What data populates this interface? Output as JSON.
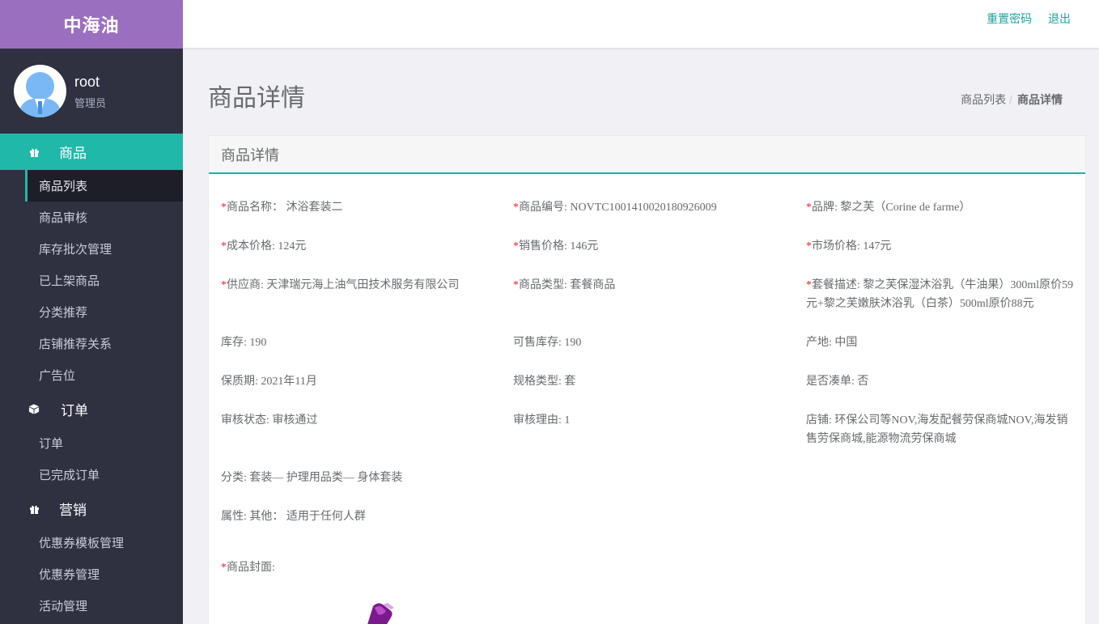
{
  "brand": "中海油",
  "user": {
    "name": "root",
    "role": "管理员"
  },
  "nav": {
    "group_goods": "商品",
    "goods_items": [
      "商品列表",
      "商品审核",
      "库存批次管理",
      "已上架商品",
      "分类推荐",
      "店铺推荐关系",
      "广告位"
    ],
    "group_orders": "订单",
    "order_items": [
      "订单",
      "已完成订单"
    ],
    "group_marketing": "营销",
    "marketing_items": [
      "优惠券模板管理",
      "优惠券管理",
      "活动管理"
    ]
  },
  "header": {
    "reset_password": "重置密码",
    "logout": "退出"
  },
  "page": {
    "title": "商品详情",
    "breadcrumb": [
      "商品列表",
      "/",
      "商品详情"
    ],
    "card_title": "商品详情"
  },
  "fields": {
    "name": {
      "label": "商品名称：",
      "value": "沐浴套装二"
    },
    "code": {
      "label": "商品编号: ",
      "value": "NOVTC1001410020180926009"
    },
    "brand": {
      "label": "品牌: ",
      "value": "黎之芙（Corine de farme）"
    },
    "cost": {
      "label": "成本价格: ",
      "value": "124元"
    },
    "sale": {
      "label": "销售价格: ",
      "value": "146元"
    },
    "market": {
      "label": "市场价格: ",
      "value": "147元"
    },
    "supplier": {
      "label": "供应商: ",
      "value": "天津瑞元海上油气田技术服务有限公司"
    },
    "type": {
      "label": "商品类型: ",
      "value": "套餐商品"
    },
    "package": {
      "label": "套餐描述: ",
      "value": "黎之芙保湿沐浴乳（牛油果）300ml原价59元+黎之芙嫩肤沐浴乳（白茶）500ml原价88元"
    },
    "stock": {
      "label": "库存: ",
      "value": "190"
    },
    "sellable": {
      "label": "可售库存: ",
      "value": "190"
    },
    "origin": {
      "label": "产地: ",
      "value": "中国"
    },
    "shelf": {
      "label": "保质期: ",
      "value": "2021年11月"
    },
    "spec": {
      "label": "规格类型: ",
      "value": "套"
    },
    "filler": {
      "label": "是否凑单: ",
      "value": "否"
    },
    "audit_status": {
      "label": "审核状态: ",
      "value": "审核通过"
    },
    "audit_reason": {
      "label": "审核理由: ",
      "value": "1"
    },
    "shops": {
      "label": "店铺: ",
      "value": "环保公司等NOV,海发配餐劳保商城NOV,海发销售劳保商城,能源物流劳保商城"
    },
    "category": {
      "label": "分类: ",
      "value": "套装— 护理用品类— 身体套装"
    },
    "attribute": {
      "label": "属性: ",
      "value": "其他：  适用于任何人群"
    },
    "cover": {
      "label": "商品封面:"
    }
  },
  "colors": {
    "accent": "#20b8a8",
    "brand_bg": "#9b6fbf",
    "sidebar_bg": "#2f3040",
    "required": "#ed1c24"
  }
}
